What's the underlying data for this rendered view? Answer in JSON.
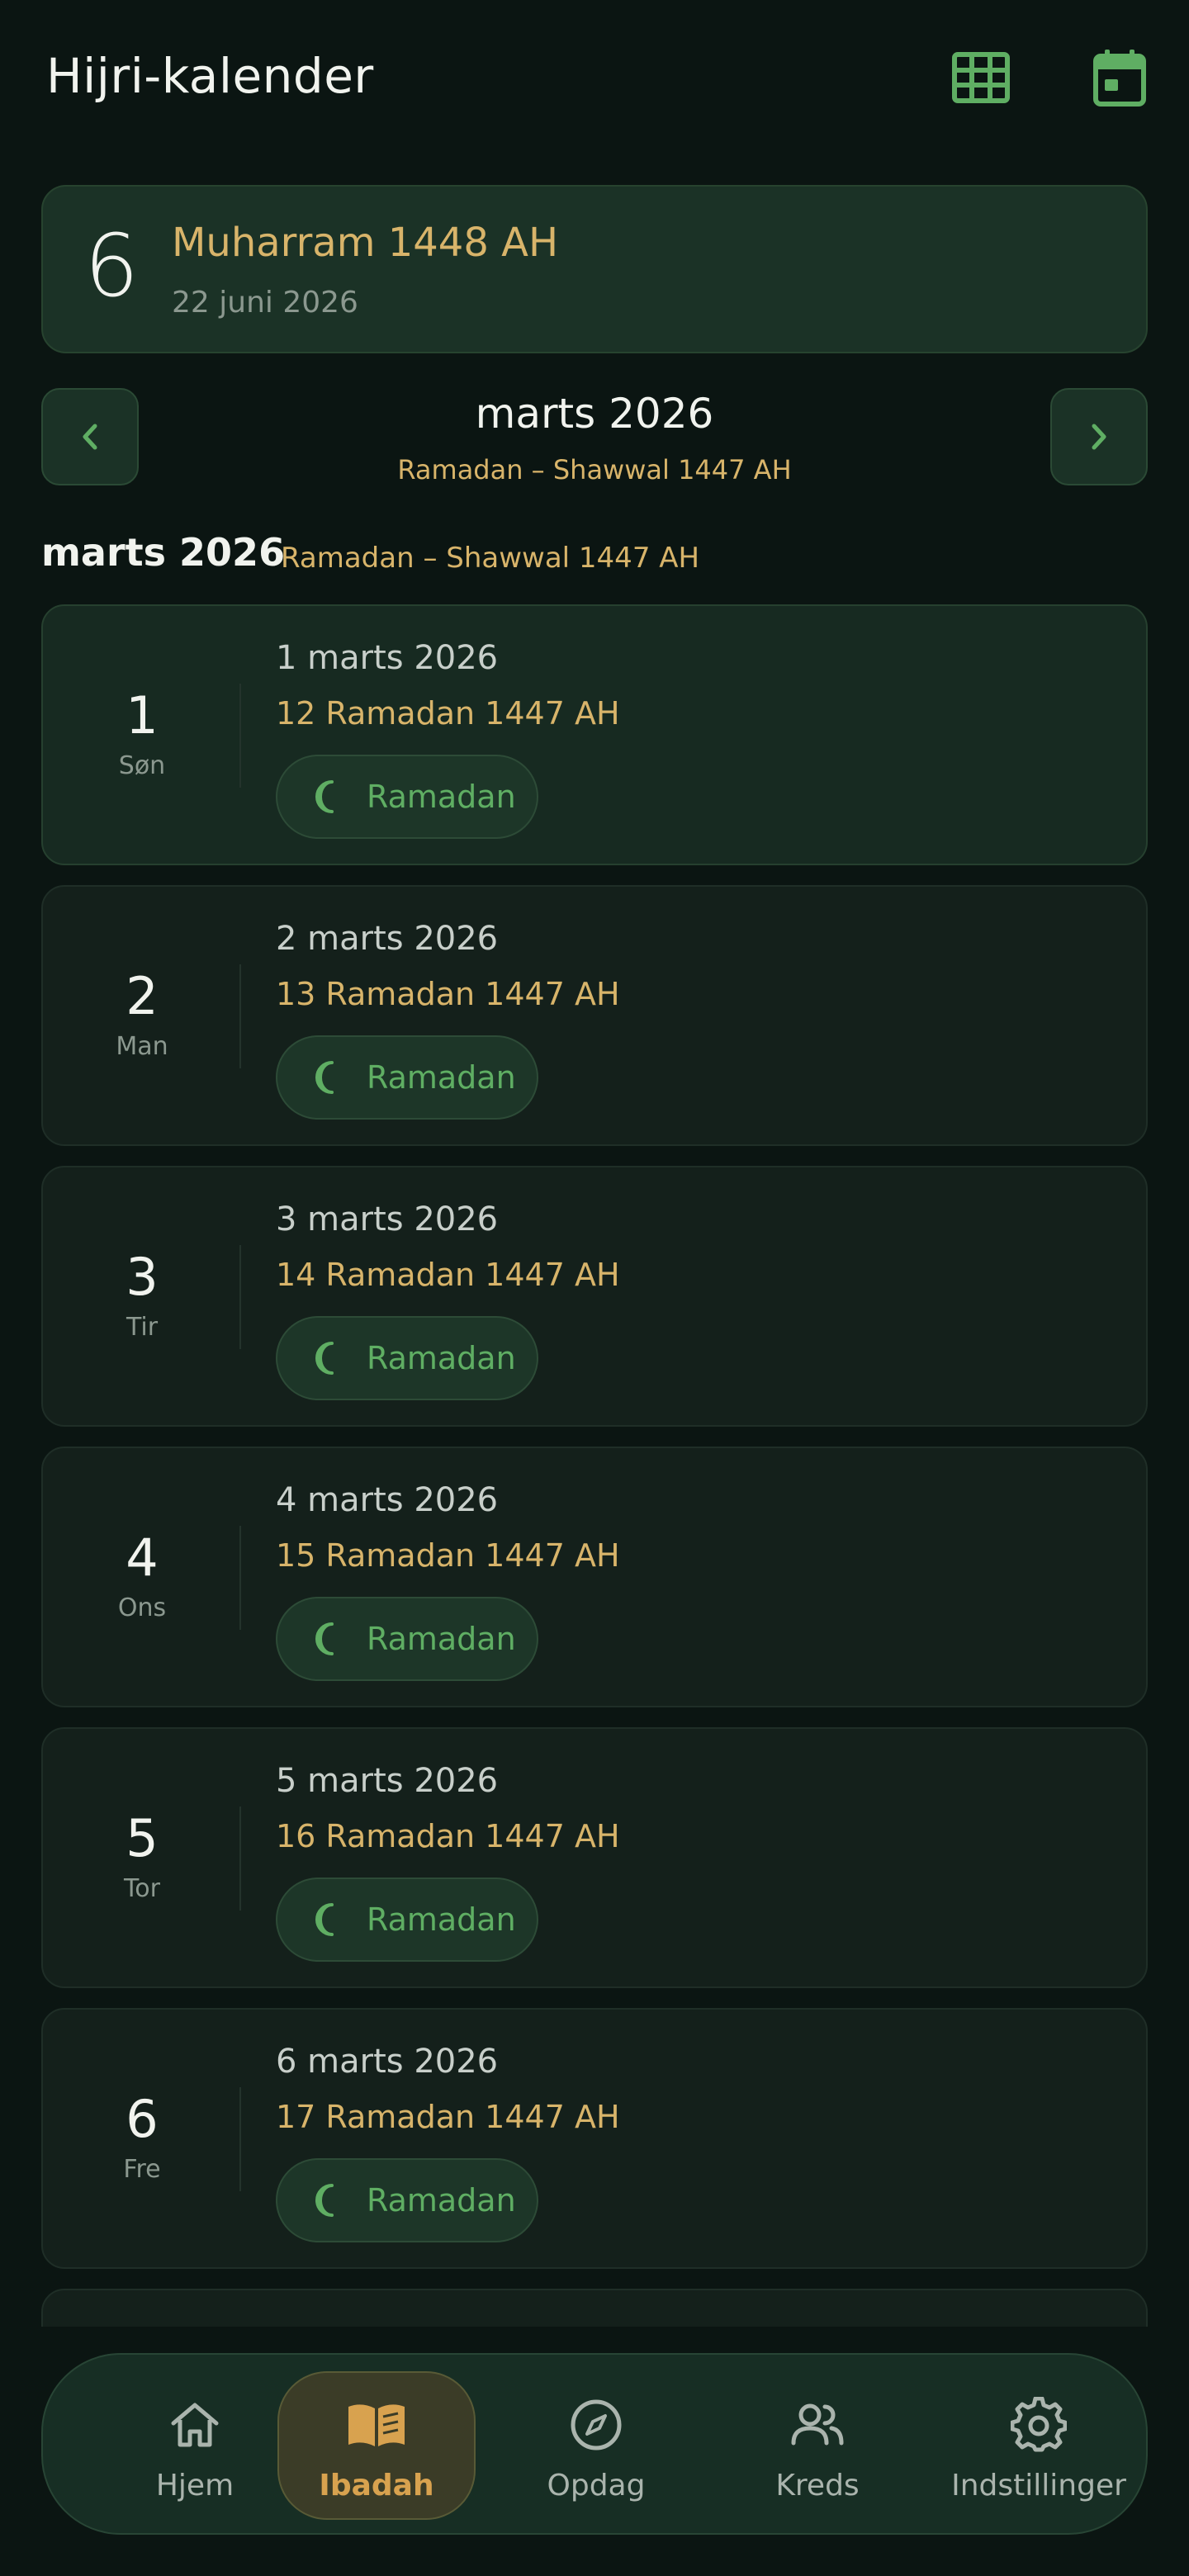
{
  "header": {
    "title": "Hijri-kalender",
    "grid_icon": "grid-icon",
    "calendar_icon": "calendar-icon"
  },
  "today": {
    "day": "6",
    "hijri": "Muharram 1448 AH",
    "gregorian": "22 juni 2026"
  },
  "month_nav": {
    "title": "marts 2026",
    "subtitle": "Ramadan – Shawwal 1447 AH"
  },
  "section": {
    "title": "marts 2026",
    "subtitle": "Ramadan – Shawwal 1447 AH"
  },
  "days": [
    {
      "num": "1",
      "weekday": "Søn",
      "gregorian": "1 marts 2026",
      "hijri": "12 Ramadan 1447 AH",
      "tag": "Ramadan"
    },
    {
      "num": "2",
      "weekday": "Man",
      "gregorian": "2 marts 2026",
      "hijri": "13 Ramadan 1447 AH",
      "tag": "Ramadan"
    },
    {
      "num": "3",
      "weekday": "Tir",
      "gregorian": "3 marts 2026",
      "hijri": "14 Ramadan 1447 AH",
      "tag": "Ramadan"
    },
    {
      "num": "4",
      "weekday": "Ons",
      "gregorian": "4 marts 2026",
      "hijri": "15 Ramadan 1447 AH",
      "tag": "Ramadan"
    },
    {
      "num": "5",
      "weekday": "Tor",
      "gregorian": "5 marts 2026",
      "hijri": "16 Ramadan 1447 AH",
      "tag": "Ramadan"
    },
    {
      "num": "6",
      "weekday": "Fre",
      "gregorian": "6 marts 2026",
      "hijri": "17 Ramadan 1447 AH",
      "tag": "Ramadan"
    }
  ],
  "bottom_nav": [
    {
      "label": "Hjem",
      "icon": "home-icon"
    },
    {
      "label": "Ibadah",
      "icon": "book-icon",
      "active": true
    },
    {
      "label": "Opdag",
      "icon": "compass-icon"
    },
    {
      "label": "Kreds",
      "icon": "people-icon"
    },
    {
      "label": "Indstillinger",
      "icon": "settings-icon"
    }
  ],
  "colors": {
    "accent_green": "#5fae63",
    "gold": "#d8b46a",
    "background": "#0b1512"
  }
}
